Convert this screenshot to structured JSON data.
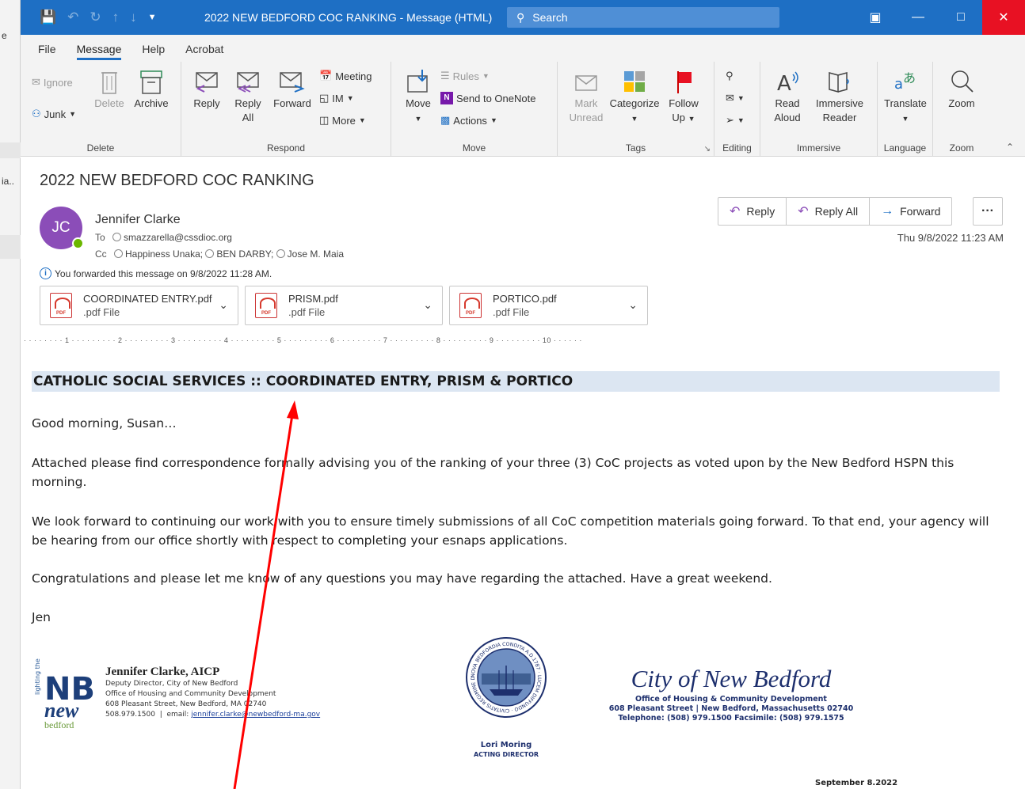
{
  "left_strip": {
    "items": [
      "e",
      "ia.."
    ]
  },
  "titlebar": {
    "title": "2022 NEW BEDFORD COC RANKING  -  Message (HTML)",
    "search_placeholder": "Search"
  },
  "menu": {
    "tabs": [
      "File",
      "Message",
      "Help",
      "Acrobat"
    ]
  },
  "ribbon": {
    "delete": {
      "group": "Delete",
      "ignore": "Ignore",
      "junk": "Junk",
      "delete": "Delete",
      "archive": "Archive"
    },
    "respond": {
      "group": "Respond",
      "reply": "Reply",
      "reply_all_1": "Reply",
      "reply_all_2": "All",
      "forward": "Forward",
      "meeting": "Meeting",
      "im": "IM",
      "more": "More"
    },
    "move": {
      "group": "Move",
      "move": "Move",
      "rules": "Rules",
      "onenote": "Send to OneNote",
      "actions": "Actions"
    },
    "tags": {
      "group": "Tags",
      "mark_1": "Mark",
      "mark_2": "Unread",
      "categorize": "Categorize",
      "follow_1": "Follow",
      "follow_2": "Up"
    },
    "editing": {
      "group": "Editing"
    },
    "immersive": {
      "group": "Immersive",
      "read_1": "Read",
      "read_2": "Aloud",
      "reader_1": "Immersive",
      "reader_2": "Reader"
    },
    "language": {
      "group": "Language",
      "translate": "Translate"
    },
    "zoom": {
      "group": "Zoom",
      "zoom": "Zoom"
    }
  },
  "message": {
    "subject": "2022 NEW BEDFORD COC RANKING",
    "avatar_initials": "JC",
    "sender": "Jennifer Clarke",
    "to_label": "To",
    "to": [
      "smazzarella@cssdioc.org"
    ],
    "cc_label": "Cc",
    "cc": [
      "Happiness Unaka;",
      "BEN DARBY;",
      "Jose M. Maia"
    ],
    "forwarded_note": "You forwarded this message on 9/8/2022 11:28 AM.",
    "datetime": "Thu 9/8/2022 11:23 AM",
    "actions": {
      "reply": "Reply",
      "reply_all": "Reply All",
      "forward": "Forward",
      "more": "···"
    },
    "attachments": [
      {
        "name": "COORDINATED ENTRY.pdf",
        "type": ".pdf File"
      },
      {
        "name": "PRISM.pdf",
        "type": ".pdf File"
      },
      {
        "name": "PORTICO.pdf",
        "type": ".pdf File"
      }
    ],
    "ruler_text": "· · · · · · · · 1 · · · · · · · · · 2 · · · · · · · · · 3 · · · · · · · · · 4 · · · · · · · · · 5 · · · · · · · · · 6 · · · · · · · · · 7 · · · · · · · · · 8 · · · · · · · · · 9 · · · · · · · · · 10 · · · · · ·"
  },
  "body": {
    "banner": "CATHOLIC SOCIAL SERVICES :: COORDINATED ENTRY, PRISM & PORTICO",
    "greeting": "Good morning, Susan…",
    "p1": "Attached please find correspondence formally advising you of the ranking of your three (3) CoC projects as voted upon by the New Bedford HSPN this morning.",
    "p2": "We look forward to continuing our work with you to ensure timely submissions of all CoC competition materials going forward. To that end, your agency will be hearing from our office shortly with respect to completing your esnaps applications.",
    "p3": "Congratulations and please let me know of any questions you may have regarding the attached.  Have a great weekend.",
    "signoff": "Jen"
  },
  "signature": {
    "name": "Jennifer Clarke, AICP",
    "title": "Deputy Director, City of New Bedford",
    "office": "Office of Housing and Community Development",
    "address": "608 Pleasant Street, New Bedford, MA 02740",
    "phone": "508.979.1500",
    "email_label": "email:",
    "email": "jennifer.clarke@newbedford-ma.gov",
    "logo_text": {
      "nb": "NB",
      "new": "new",
      "bedford": "bedford",
      "tagline": "lighting the way"
    }
  },
  "letterhead": {
    "seal_text": "NOVA BEDFORDIA CONDITA A.D.1787 · LUCEM DIFFUNDO · CIVITATIS REGIMINE DONATA A.D.1847",
    "director_name": "Lori Moring",
    "director_title": "ACTING DIRECTOR",
    "city_script": "City of New Bedford",
    "office": "Office of Housing & Community Development",
    "address": "608 Pleasant Street   |   New Bedford, Massachusetts  02740",
    "phone": "Telephone: (508) 979.1500   Facsimile: (508) 979.1575",
    "date": "September 8.2022"
  },
  "colors": {
    "titlebar": "#1e6fc4",
    "close": "#e81123",
    "avatar": "#8b4db8",
    "banner": "#dce6f2",
    "annotation": "#ff0000"
  }
}
